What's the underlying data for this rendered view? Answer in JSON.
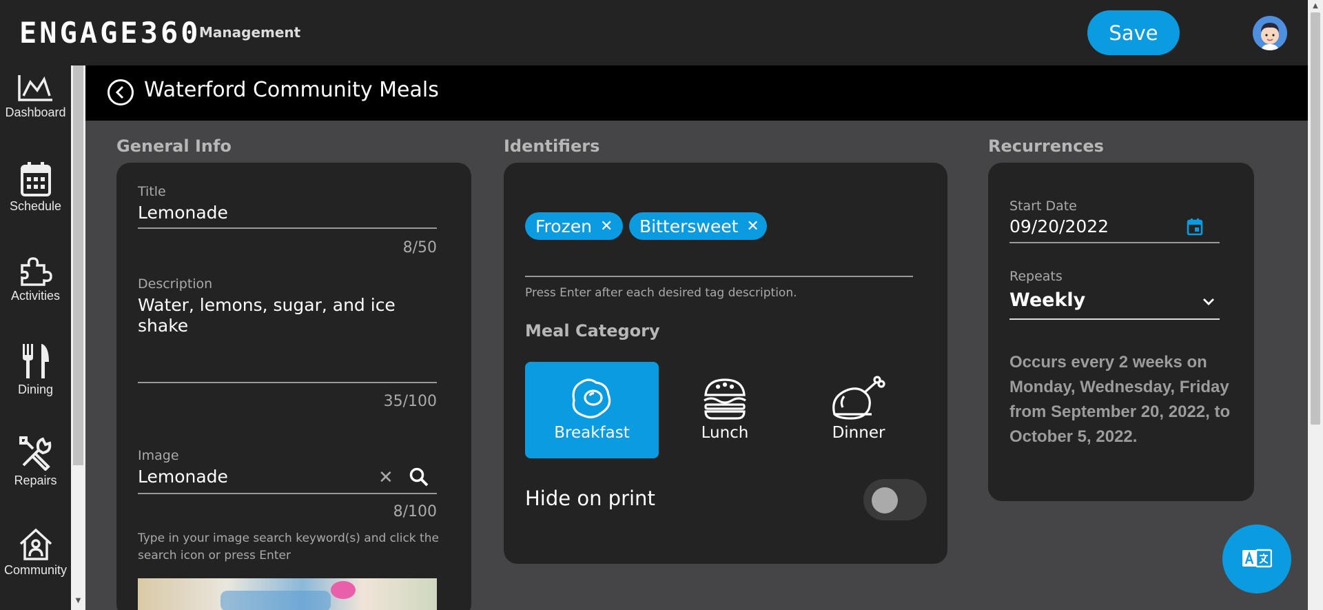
{
  "app": {
    "brand": "ENGAGE360",
    "brand_sub": "Management",
    "save_label": "Save",
    "accent": "#0a9be0"
  },
  "sidebar": {
    "items": [
      {
        "label": "Dashboard",
        "icon": "chart-icon"
      },
      {
        "label": "Schedule",
        "icon": "calendar-icon"
      },
      {
        "label": "Activities",
        "icon": "puzzle-icon"
      },
      {
        "label": "Dining",
        "icon": "fork-knife-icon"
      },
      {
        "label": "Repairs",
        "icon": "tools-icon"
      },
      {
        "label": "Community",
        "icon": "home-icon"
      }
    ]
  },
  "header": {
    "title": "Waterford Community Meals"
  },
  "general_info": {
    "section_title": "General Info",
    "title_label": "Title",
    "title_value": "Lemonade",
    "title_counter": "8/50",
    "description_label": "Description",
    "description_value": "Water, lemons, sugar, and ice shake",
    "description_counter": "35/100",
    "image_label": "Image",
    "image_value": "Lemonade",
    "image_counter": "8/100",
    "image_helper": "Type in your image search keyword(s) and click the search icon or press Enter"
  },
  "identifiers": {
    "section_title": "Identifiers",
    "tags": [
      "Frozen",
      "Bittersweet"
    ],
    "tag_helper": "Press Enter after each desired tag description.",
    "meal_category_title": "Meal Category",
    "meals": [
      {
        "label": "Breakfast",
        "selected": true
      },
      {
        "label": "Lunch",
        "selected": false
      },
      {
        "label": "Dinner",
        "selected": false
      }
    ],
    "hide_on_print_label": "Hide on print",
    "hide_on_print": false
  },
  "recurrences": {
    "section_title": "Recurrences",
    "start_date_label": "Start Date",
    "start_date_value": "09/20/2022",
    "repeats_label": "Repeats",
    "repeats_value": "Weekly",
    "summary": "Occurs every 2 weeks on Monday, Wednesday, Friday from September 20, 2022, to October 5, 2022."
  }
}
